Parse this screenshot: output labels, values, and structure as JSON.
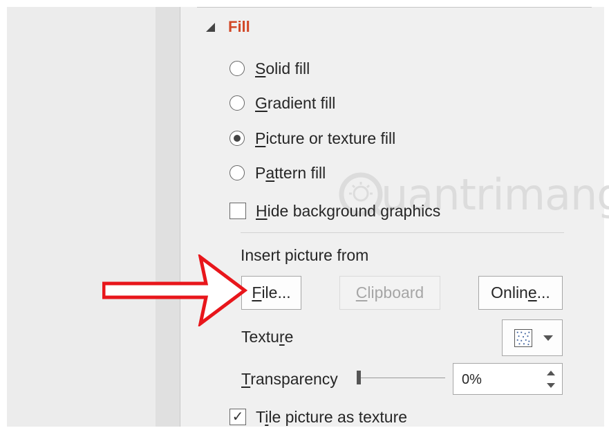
{
  "section": {
    "title": "Fill",
    "collapse_icon": "triangle-expanded-icon"
  },
  "fill_options": [
    {
      "pre": "",
      "key": "S",
      "post": "olid fill",
      "checked": false
    },
    {
      "pre": "",
      "key": "G",
      "post": "radient fill",
      "checked": false
    },
    {
      "pre": "",
      "key": "P",
      "post": "icture or texture fill",
      "checked": true
    },
    {
      "pre": "P",
      "key": "a",
      "post": "ttern fill",
      "checked": false
    }
  ],
  "hide_background": {
    "pre": "",
    "key": "H",
    "post": "ide background graphics",
    "checked": false
  },
  "insert_picture": {
    "heading": "Insert picture from",
    "file": {
      "pre": "",
      "key": "F",
      "post": "ile..."
    },
    "clipboard": {
      "pre": "",
      "key": "C",
      "post": "lipboard",
      "enabled": false
    },
    "online": {
      "pre": "Onlin",
      "key": "e",
      "post": "..."
    }
  },
  "texture": {
    "pre": "Textu",
    "key": "r",
    "post": "e",
    "swatch_icon": "texture-pattern-icon"
  },
  "transparency": {
    "pre": "",
    "key": "T",
    "post": "ransparency",
    "value": "0%",
    "slider_level": 0
  },
  "tile": {
    "pre": "T",
    "key": "i",
    "post": "le picture as texture",
    "checked": true
  },
  "watermark": {
    "text": "uantrimang",
    "logo_icon": "quantrimang-logo-icon"
  },
  "annotation": {
    "arrow_icon": "red-arrow-icon",
    "color": "#e8161b"
  },
  "colors": {
    "accent": "#d24726",
    "text": "#262626",
    "panel": "#f0f0f0"
  }
}
